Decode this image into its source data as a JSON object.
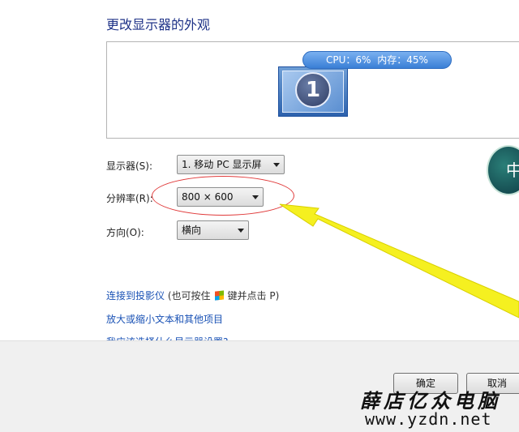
{
  "header": {
    "title": "更改显示器的外观"
  },
  "preview": {
    "monitor_number": "1",
    "status": {
      "cpu": "CPU：6%",
      "memory": "内存：45%"
    }
  },
  "settings": {
    "display": {
      "label": "显示器(S):",
      "value": "1. 移动 PC 显示屏"
    },
    "resolution": {
      "label": "分辨率(R):",
      "value": "800 × 600"
    },
    "orientation": {
      "label": "方向(O):",
      "value": "横向"
    }
  },
  "badge": {
    "text": "中"
  },
  "links": {
    "projector": "连接到投影仪",
    "projector_hint_before": "(也可按住",
    "projector_hint_after": "键并点击 P)",
    "text_size": "放大或缩小文本和其他项目",
    "which_settings": "我应该选择什么显示器设置?"
  },
  "buttons": {
    "ok": "确定",
    "cancel": "取消"
  },
  "watermark": {
    "title": "薛店亿众电脑",
    "url": "www.yzdn.net"
  },
  "colors": {
    "link": "#1a52b5",
    "annotation_ellipse": "#e03a3a",
    "annotation_arrow": "#f5f020"
  }
}
